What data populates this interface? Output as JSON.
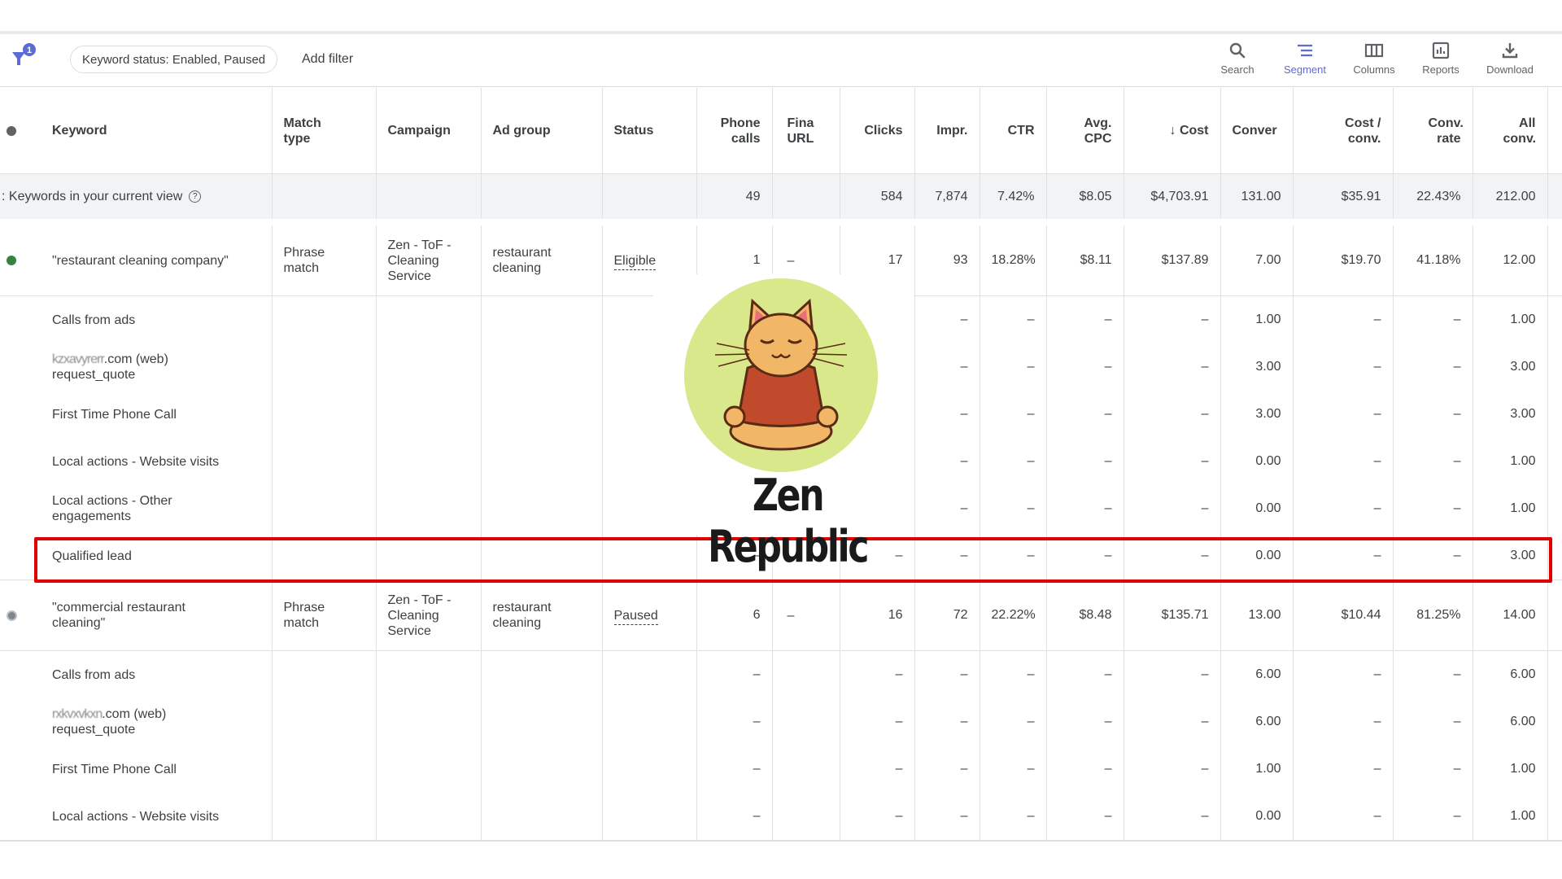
{
  "toolbar": {
    "filter_badge_count": "1",
    "filter_chip": "Keyword status: Enabled, Paused",
    "add_filter": "Add filter",
    "tools": [
      {
        "label": "Search",
        "icon": "search-icon",
        "active": false
      },
      {
        "label": "Segment",
        "icon": "segment-icon",
        "active": true
      },
      {
        "label": "Columns",
        "icon": "columns-icon",
        "active": false
      },
      {
        "label": "Reports",
        "icon": "reports-icon",
        "active": false
      },
      {
        "label": "Download",
        "icon": "download-icon",
        "active": false
      }
    ],
    "accent_color": "#5c6bd6"
  },
  "table": {
    "columns": [
      "Keyword",
      "Match type",
      "Campaign",
      "Ad group",
      "Status",
      "Phone calls",
      "Final URL",
      "Clicks",
      "Impr.",
      "CTR",
      "Avg. CPC",
      "Cost",
      "Conversions",
      "Cost / conv.",
      "Conv. rate",
      "All conv."
    ],
    "column_headers": {
      "keyword": "Keyword",
      "match_type": "Match type",
      "campaign": "Campaign",
      "ad_group": "Ad group",
      "status": "Status",
      "phone_calls": "Phone calls",
      "final_url": "Fina URL",
      "clicks": "Clicks",
      "impr": "Impr.",
      "ctr": "CTR",
      "avg_cpc": "Avg. CPC",
      "cost": "↓ Cost",
      "conversions": "Conver",
      "cost_per_conv": "Cost / conv.",
      "conv_rate": "Conv. rate",
      "all_conv": "All conv."
    },
    "total": {
      "label": ": Keywords in your current view",
      "phone_calls": "49",
      "final_url": "",
      "clicks": "584",
      "impr": "7,874",
      "ctr": "7.42%",
      "avg_cpc": "$8.05",
      "cost": "$4,703.91",
      "conversions": "131.00",
      "cost_per_conv": "$35.91",
      "conv_rate": "22.43%",
      "all_conv": "212.00"
    },
    "keywords": [
      {
        "status_dot": "enabled",
        "keyword": "\"restaurant cleaning company\"",
        "match_type": "Phrase match",
        "campaign": "Zen - ToF - Cleaning Service",
        "ad_group": "restaurant cleaning",
        "status": "Eligible",
        "phone_calls": "1",
        "final_url": "–",
        "clicks": "17",
        "impr": "93",
        "ctr": "18.28%",
        "avg_cpc": "$8.11",
        "cost": "$137.89",
        "conversions": "7.00",
        "cost_per_conv": "$19.70",
        "conv_rate": "41.18%",
        "all_conv": "12.00",
        "segments": [
          {
            "name": "Calls from ads",
            "phone_calls": "",
            "clicks": "",
            "impr": "–",
            "ctr": "–",
            "avg_cpc": "–",
            "cost": "–",
            "conversions": "1.00",
            "cost_per_conv": "–",
            "conv_rate": "–",
            "all_conv": "1.00"
          },
          {
            "name": "[redacted].com (web) request_quote",
            "name_prefix": "kzxavyrerr",
            "name_suffix": ".com (web)",
            "name_line2": "request_quote",
            "phone_calls": "",
            "clicks": "",
            "impr": "–",
            "ctr": "–",
            "avg_cpc": "–",
            "cost": "–",
            "conversions": "3.00",
            "cost_per_conv": "–",
            "conv_rate": "–",
            "all_conv": "3.00"
          },
          {
            "name": "First Time Phone Call",
            "phone_calls": "",
            "clicks": "",
            "impr": "–",
            "ctr": "–",
            "avg_cpc": "–",
            "cost": "–",
            "conversions": "3.00",
            "cost_per_conv": "–",
            "conv_rate": "–",
            "all_conv": "3.00"
          },
          {
            "name": "Local actions - Website visits",
            "phone_calls": "",
            "clicks": "",
            "impr": "–",
            "ctr": "–",
            "avg_cpc": "–",
            "cost": "–",
            "conversions": "0.00",
            "cost_per_conv": "–",
            "conv_rate": "–",
            "all_conv": "1.00"
          },
          {
            "name": "Local actions - Other engagements",
            "phone_calls": "",
            "clicks": "",
            "impr": "–",
            "ctr": "–",
            "avg_cpc": "–",
            "cost": "–",
            "conversions": "0.00",
            "cost_per_conv": "–",
            "conv_rate": "–",
            "all_conv": "1.00"
          },
          {
            "name": "Qualified lead",
            "phone_calls": "–",
            "clicks": "–",
            "impr": "–",
            "ctr": "–",
            "avg_cpc": "–",
            "cost": "–",
            "conversions": "0.00",
            "cost_per_conv": "–",
            "conv_rate": "–",
            "all_conv": "3.00",
            "highlighted": true
          }
        ]
      },
      {
        "status_dot": "paused",
        "keyword": "\"commercial restaurant cleaning\"",
        "match_type": "Phrase match",
        "campaign": "Zen - ToF - Cleaning Service",
        "ad_group": "restaurant cleaning",
        "status": "Paused",
        "phone_calls": "6",
        "final_url": "–",
        "clicks": "16",
        "impr": "72",
        "ctr": "22.22%",
        "avg_cpc": "$8.48",
        "cost": "$135.71",
        "conversions": "13.00",
        "cost_per_conv": "$10.44",
        "conv_rate": "81.25%",
        "all_conv": "14.00",
        "segments": [
          {
            "name": "Calls from ads",
            "phone_calls": "–",
            "clicks": "–",
            "impr": "–",
            "ctr": "–",
            "avg_cpc": "–",
            "cost": "–",
            "conversions": "6.00",
            "cost_per_conv": "–",
            "conv_rate": "–",
            "all_conv": "6.00"
          },
          {
            "name": "[redacted].com (web) request_quote",
            "name_prefix": "rxkvxvkxn",
            "name_suffix": ".com (web)",
            "name_line2": "request_quote",
            "phone_calls": "–",
            "clicks": "–",
            "impr": "–",
            "ctr": "–",
            "avg_cpc": "–",
            "cost": "–",
            "conversions": "6.00",
            "cost_per_conv": "–",
            "conv_rate": "–",
            "all_conv": "6.00"
          },
          {
            "name": "First Time Phone Call",
            "phone_calls": "–",
            "clicks": "–",
            "impr": "–",
            "ctr": "–",
            "avg_cpc": "–",
            "cost": "–",
            "conversions": "1.00",
            "cost_per_conv": "–",
            "conv_rate": "–",
            "all_conv": "1.00"
          },
          {
            "name": "Local actions - Website visits",
            "phone_calls": "–",
            "clicks": "–",
            "impr": "–",
            "ctr": "–",
            "avg_cpc": "–",
            "cost": "–",
            "conversions": "0.00",
            "cost_per_conv": "–",
            "conv_rate": "–",
            "all_conv": "1.00"
          }
        ]
      }
    ],
    "help_icon": "?"
  },
  "overlay": {
    "brand_name": "Zen Republic",
    "logo_description": "meditating cat in red sweater on light green circle",
    "logo_circle_color": "#d8e88a",
    "highlight_color": "#e00000"
  }
}
